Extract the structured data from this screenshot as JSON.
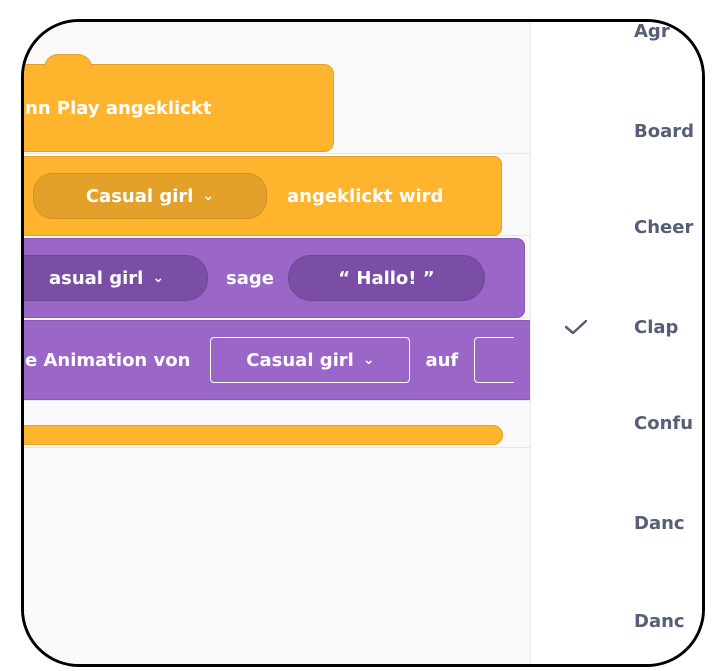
{
  "blocks": {
    "hat_label": "nn Play angeklickt",
    "when_clicked": {
      "sprite": "Casual girl",
      "suffix": "angeklickt wird"
    },
    "say": {
      "sprite": "asual girl",
      "verb": "sage",
      "message": "“ Hallo! ”"
    },
    "set_animation": {
      "prefix": "e Animation von",
      "sprite": "Casual girl",
      "verb": "auf"
    }
  },
  "dropdown": {
    "items": [
      {
        "label": "Agr",
        "selected": false
      },
      {
        "label": "Board",
        "selected": false
      },
      {
        "label": "Cheer",
        "selected": false
      },
      {
        "label": "Clap",
        "selected": true
      },
      {
        "label": "Confu",
        "selected": false
      },
      {
        "label": "Danc",
        "selected": false
      },
      {
        "label": "Danc",
        "selected": false
      }
    ]
  },
  "icons": {
    "chevron": "chevron-down-icon",
    "check": "check-icon"
  },
  "colors": {
    "event": "#ffb42e",
    "looks": "#9a66c8",
    "menu_text": "#575e75"
  }
}
